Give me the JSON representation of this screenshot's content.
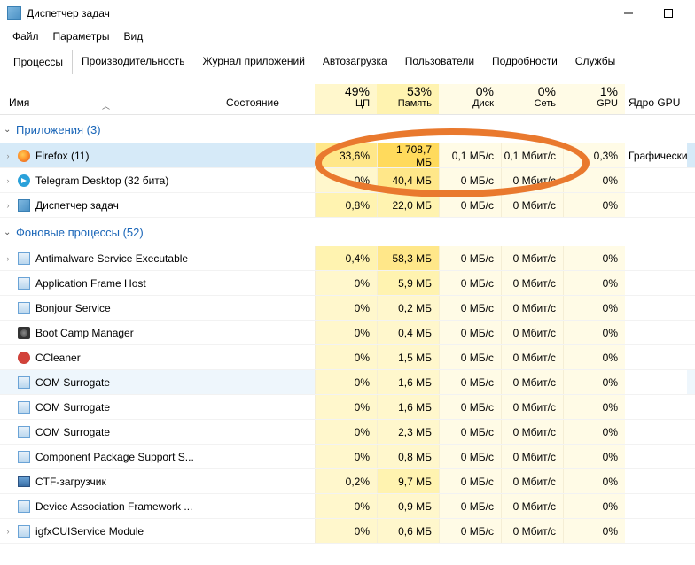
{
  "window": {
    "title": "Диспетчер задач"
  },
  "menu": {
    "file": "Файл",
    "options": "Параметры",
    "view": "Вид"
  },
  "tabs": {
    "processes": "Процессы",
    "performance": "Производительность",
    "appHistory": "Журнал приложений",
    "startup": "Автозагрузка",
    "users": "Пользователи",
    "details": "Подробности",
    "services": "Службы"
  },
  "columns": {
    "name": "Имя",
    "state": "Состояние",
    "cpu": {
      "pct": "49%",
      "label": "ЦП"
    },
    "mem": {
      "pct": "53%",
      "label": "Память"
    },
    "disk": {
      "pct": "0%",
      "label": "Диск"
    },
    "net": {
      "pct": "0%",
      "label": "Сеть"
    },
    "gpu": {
      "pct": "1%",
      "label": "GPU"
    },
    "gpuEngine": "Ядро GPU"
  },
  "groups": {
    "apps": "Приложения (3)",
    "bg": "Фоновые процессы (52)"
  },
  "rows": {
    "apps": [
      {
        "name": "Firefox (11)",
        "icon": "ff",
        "exp": true,
        "cpu": "33,6%",
        "mem": "1 708,7 МБ",
        "disk": "0,1 МБ/с",
        "net": "0,1 Мбит/с",
        "gpu": "0,3%",
        "gpue": "Графически",
        "hl": true
      },
      {
        "name": "Telegram Desktop (32 бита)",
        "icon": "tg",
        "exp": true,
        "cpu": "0%",
        "mem": "40,4 МБ",
        "disk": "0 МБ/с",
        "net": "0 Мбит/с",
        "gpu": "0%",
        "gpue": ""
      },
      {
        "name": "Диспетчер задач",
        "icon": "tm",
        "exp": true,
        "cpu": "0,8%",
        "mem": "22,0 МБ",
        "disk": "0 МБ/с",
        "net": "0 Мбит/с",
        "gpu": "0%",
        "gpue": ""
      }
    ],
    "bg": [
      {
        "name": "Antimalware Service Executable",
        "icon": "app",
        "exp": true,
        "cpu": "0,4%",
        "mem": "58,3 МБ",
        "disk": "0 МБ/с",
        "net": "0 Мбит/с",
        "gpu": "0%",
        "gpue": ""
      },
      {
        "name": "Application Frame Host",
        "icon": "app",
        "exp": false,
        "cpu": "0%",
        "mem": "5,9 МБ",
        "disk": "0 МБ/с",
        "net": "0 Мбит/с",
        "gpu": "0%",
        "gpue": ""
      },
      {
        "name": "Bonjour Service",
        "icon": "app",
        "exp": false,
        "cpu": "0%",
        "mem": "0,2 МБ",
        "disk": "0 МБ/с",
        "net": "0 Мбит/с",
        "gpu": "0%",
        "gpue": ""
      },
      {
        "name": "Boot Camp Manager",
        "icon": "bc",
        "exp": false,
        "cpu": "0%",
        "mem": "0,4 МБ",
        "disk": "0 МБ/с",
        "net": "0 Мбит/с",
        "gpu": "0%",
        "gpue": ""
      },
      {
        "name": "CCleaner",
        "icon": "cc",
        "exp": false,
        "cpu": "0%",
        "mem": "1,5 МБ",
        "disk": "0 МБ/с",
        "net": "0 Мбит/с",
        "gpu": "0%",
        "gpue": ""
      },
      {
        "name": "COM Surrogate",
        "icon": "app",
        "exp": false,
        "cpu": "0%",
        "mem": "1,6 МБ",
        "disk": "0 МБ/с",
        "net": "0 Мбит/с",
        "gpu": "0%",
        "gpue": "",
        "hl": true,
        "light": true
      },
      {
        "name": "COM Surrogate",
        "icon": "app",
        "exp": false,
        "cpu": "0%",
        "mem": "1,6 МБ",
        "disk": "0 МБ/с",
        "net": "0 Мбит/с",
        "gpu": "0%",
        "gpue": ""
      },
      {
        "name": "COM Surrogate",
        "icon": "app",
        "exp": false,
        "cpu": "0%",
        "mem": "2,3 МБ",
        "disk": "0 МБ/с",
        "net": "0 Мбит/с",
        "gpu": "0%",
        "gpue": ""
      },
      {
        "name": "Component Package Support S...",
        "icon": "app",
        "exp": false,
        "cpu": "0%",
        "mem": "0,8 МБ",
        "disk": "0 МБ/с",
        "net": "0 Мбит/с",
        "gpu": "0%",
        "gpue": ""
      },
      {
        "name": "CTF-загрузчик",
        "icon": "ctf",
        "exp": false,
        "cpu": "0,2%",
        "mem": "9,7 МБ",
        "disk": "0 МБ/с",
        "net": "0 Мбит/с",
        "gpu": "0%",
        "gpue": ""
      },
      {
        "name": "Device Association Framework ...",
        "icon": "app",
        "exp": false,
        "cpu": "0%",
        "mem": "0,9 МБ",
        "disk": "0 МБ/с",
        "net": "0 Мбит/с",
        "gpu": "0%",
        "gpue": ""
      },
      {
        "name": "igfxCUIService Module",
        "icon": "app",
        "exp": true,
        "cpu": "0%",
        "mem": "0,6 МБ",
        "disk": "0 МБ/с",
        "net": "0 Мбит/с",
        "gpu": "0%",
        "gpue": ""
      }
    ]
  }
}
